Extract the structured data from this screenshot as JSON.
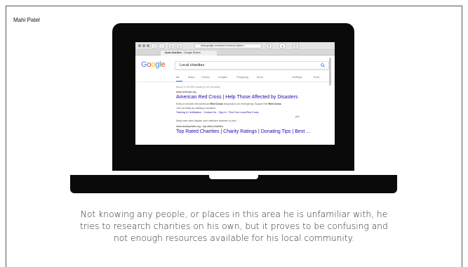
{
  "slide": {
    "author": "Mahi Patel",
    "caption_lines": [
      "Not knowing any people, or places in this area he is unfamiliar with, he",
      "tries to research charities on his own, but it proves to be confusing and",
      "not enough resources available for his local community."
    ]
  },
  "browser": {
    "nav_back": "<",
    "nav_fwd": ">",
    "nav_font_small": "A",
    "nav_font_large": "A",
    "address": "www.google.com/search?source=hp&ei=...",
    "tab_label_query": "local charities",
    "tab_label_suffix": "- Google Search",
    "logo": {
      "g1": "G",
      "o1": "o",
      "o2": "o",
      "g2": "g",
      "l": "l",
      "e": "e"
    },
    "search_query": "Local charities",
    "search_icon": "magnifier-icon",
    "tabs": [
      "All",
      "Maps",
      "Videos",
      "Images",
      "Shopping",
      "More"
    ],
    "tools": [
      "Settings",
      "Tools"
    ],
    "stats": "About 3,170,000 results (0.39 seconds)",
    "results": [
      {
        "url": "www.redcross.org",
        "title": "American Red Cross | Help Those Affected by Disasters",
        "snippet1_a": "Every 8 minutes the American ",
        "snippet1_b": "Red Cross",
        "snippet1_c": " responds to an emergency. Support the ",
        "snippet1_d": "Red Cross",
        "snippet2": "Join us today by making a donation.",
        "links": "Training & Certification · Contact Us · Sign In · Find Your Local Red Cross",
        "side": "yeh",
        "note": "Many web sites disable user interface features in your ..."
      },
      {
        "url": "www.charitywatch.org › top-rated-charities",
        "title": "Top Rated Charities | Charity Ratings | Donating Tips | Best ..."
      }
    ]
  },
  "colors": {
    "laptop": "#0a0a0a",
    "link": "#1a0dab",
    "google_blue": "#4285f4",
    "google_red": "#ea4335",
    "google_yellow": "#fbbc05",
    "google_green": "#34a853"
  }
}
